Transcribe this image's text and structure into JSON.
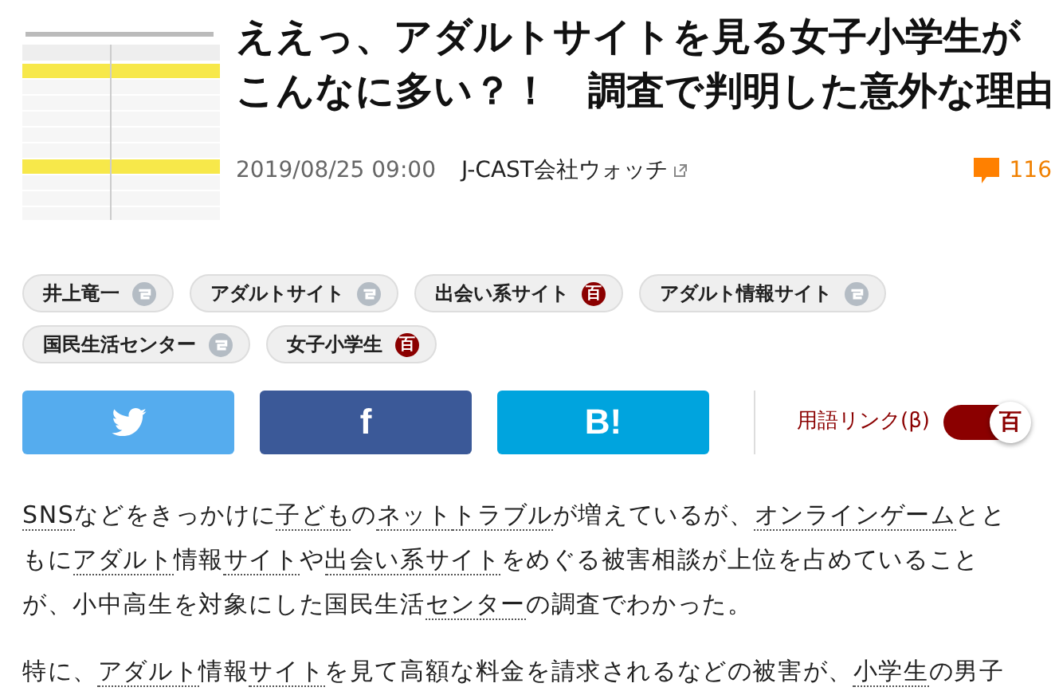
{
  "title": "ええっ、アダルトサイトを見る女子小学生がこんなに多い？！　調査で判明した意外な理由",
  "meta": {
    "date": "2019/08/25 09:00",
    "source": "J-CAST会社ウォッチ",
    "comments": "116"
  },
  "tags": [
    {
      "label": "井上竜一",
      "kind": "wiki"
    },
    {
      "label": "アダルトサイト",
      "kind": "wiki"
    },
    {
      "label": "出会い系サイト",
      "kind": "dictionary",
      "icon_text": "百"
    },
    {
      "label": "アダルト情報サイト",
      "kind": "wiki"
    },
    {
      "label": "国民生活センター",
      "kind": "wiki"
    },
    {
      "label": "女子小学生",
      "kind": "dictionary",
      "icon_text": "百"
    }
  ],
  "share_buttons": [
    {
      "kind": "twitter",
      "color": "#55acee"
    },
    {
      "kind": "facebook",
      "label": "f",
      "color": "#3b5998"
    },
    {
      "kind": "hatena",
      "label": "B!",
      "color": "#00a4de"
    }
  ],
  "term_link_toggle": {
    "label": "用語リンク(β)",
    "on": true,
    "knob_text": "百"
  },
  "paragraphs": [
    [
      {
        "text": "SNS",
        "link": true
      },
      {
        "text": "などをきっかけに",
        "link": false
      },
      {
        "text": "子ども",
        "link": true
      },
      {
        "text": "の",
        "link": false
      },
      {
        "text": "ネット",
        "link": true
      },
      {
        "text": "トラブル",
        "link": true
      },
      {
        "text": "が増えているが、",
        "link": false
      },
      {
        "text": "オンラインゲーム",
        "link": true
      },
      {
        "text": "とともに",
        "link": false
      },
      {
        "text": "アダルト",
        "link": true
      },
      {
        "text": "情報",
        "link": false
      },
      {
        "text": "サイト",
        "link": true
      },
      {
        "text": "や",
        "link": false
      },
      {
        "text": "出会い系サイト",
        "link": true
      },
      {
        "text": "をめぐる被害相談が上位を占めていることが、小中高生を対象にした国民生活",
        "link": false
      },
      {
        "text": "センター",
        "link": true
      },
      {
        "text": "の調査でわかった。",
        "link": false
      }
    ],
    [
      {
        "text": "特に、",
        "link": false
      },
      {
        "text": "アダルト",
        "link": true
      },
      {
        "text": "情報",
        "link": false
      },
      {
        "text": "サイト",
        "link": true
      },
      {
        "text": "を見て高額な料金を請求されるなどの被害が、",
        "link": false
      },
      {
        "text": "小学生",
        "link": true
      },
      {
        "text": "の男子",
        "link": false
      }
    ]
  ]
}
